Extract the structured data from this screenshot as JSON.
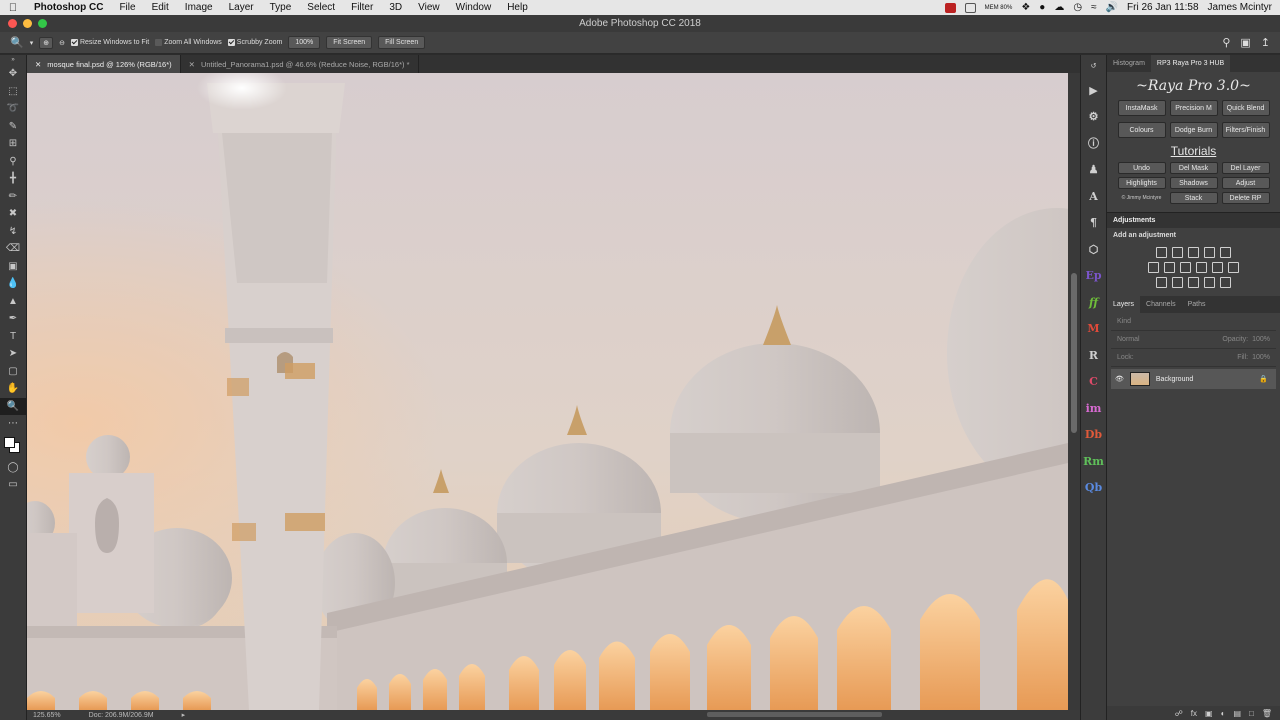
{
  "menubar": {
    "app": "Photoshop CC",
    "items": [
      "File",
      "Edit",
      "Image",
      "Layer",
      "Type",
      "Select",
      "Filter",
      "3D",
      "View",
      "Window",
      "Help"
    ],
    "memory": "MEM 80%",
    "datetime": "Fri 26 Jan  11:58",
    "user": "James Mcintyr"
  },
  "window": {
    "title": "Adobe Photoshop CC 2018"
  },
  "options": {
    "resize_windows": "Resize Windows to Fit",
    "zoom_all": "Zoom All Windows",
    "scrubby_zoom": "Scrubby Zoom",
    "zoom_value": "100%",
    "fit_screen": "Fit Screen",
    "fill_screen": "Fill Screen"
  },
  "tabs": [
    {
      "label": "mosque final.psd @ 126% (RGB/16*)",
      "active": true
    },
    {
      "label": "Untitled_Panorama1.psd @ 46.6% (Reduce Noise, RGB/16*) *",
      "active": false
    }
  ],
  "status": {
    "zoom": "125.65%",
    "doc": "Doc: 206.9M/206.9M"
  },
  "raya": {
    "tab_histogram": "Histogram",
    "tab_raya": "RP3 Raya Pro 3 HUB",
    "title": "~Raya Pro 3.0~",
    "row1": [
      "InstaMask",
      "Precision M",
      "Quick Blend"
    ],
    "row2": [
      "Colours",
      "Dodge Burn",
      "Filters/Finish"
    ],
    "tutorials": "Tutorials",
    "row3": [
      "Undo",
      "Del Mask",
      "Del Layer"
    ],
    "row4": [
      "Highlights",
      "Shadows",
      "Adjust"
    ],
    "copyright": "© Jimmy Mcintyre",
    "row5": [
      "Stack",
      "Delete RP"
    ]
  },
  "adjustments": {
    "header": "Adjustments",
    "add": "Add an adjustment"
  },
  "layers": {
    "tabs": [
      "Layers",
      "Channels",
      "Paths"
    ],
    "kind": "Kind",
    "blend": "Normal",
    "opacity": "Opacity:",
    "opacity_val": "100%",
    "lock": "Lock:",
    "fill": "Fill:",
    "fill_val": "100%",
    "background_layer": "Background"
  },
  "panel_icon_labels": [
    "Ep",
    "ff",
    "M",
    "R",
    "C",
    "im",
    "Db",
    "Rm",
    "Qb"
  ],
  "colors": {
    "accent": "#d7a05f",
    "panel_bg": "#404040",
    "canvas_sky": "#d9cdc8"
  }
}
